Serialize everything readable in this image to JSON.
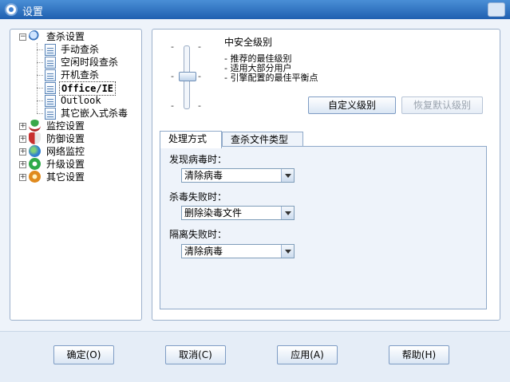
{
  "window": {
    "title": "设置"
  },
  "tree": {
    "root": {
      "label": "查杀设置",
      "icon": "magnifier-bug-icon"
    },
    "children": [
      {
        "label": "手动查杀"
      },
      {
        "label": "空闲时段查杀"
      },
      {
        "label": "开机查杀"
      },
      {
        "label": "Office/IE",
        "selected": true
      },
      {
        "label": "Outlook"
      },
      {
        "label": "其它嵌入式杀毒"
      }
    ],
    "categories": [
      {
        "label": "监控设置",
        "icon": "umbrella-icon"
      },
      {
        "label": "防御设置",
        "icon": "shield-icon"
      },
      {
        "label": "网络监控",
        "icon": "globe-icon"
      },
      {
        "label": "升级设置",
        "icon": "update-icon"
      },
      {
        "label": "其它设置",
        "icon": "gear-icon"
      }
    ]
  },
  "security_level": {
    "title": "中安全级别",
    "bullets": [
      "- 推荐的最佳级别",
      "- 适用大部分用户",
      "- 引擎配置的最佳平衡点"
    ],
    "tick_mark": "-",
    "level_index": 1,
    "level_count": 3,
    "custom_button": "自定义级别",
    "restore_button": "恢复默认级别"
  },
  "tabs": [
    {
      "label": "处理方式",
      "active": true
    },
    {
      "label": "查杀文件类型",
      "active": false
    }
  ],
  "handling": {
    "found_virus": {
      "label": "发现病毒时：",
      "value": "清除病毒"
    },
    "kill_failed": {
      "label": "杀毒失败时：",
      "value": "删除染毒文件"
    },
    "quarantine_failed": {
      "label": "隔离失败时：",
      "value": "清除病毒"
    }
  },
  "footer": {
    "ok": "确定(O)",
    "cancel": "取消(C)",
    "apply": "应用(A)",
    "help": "帮助(H)"
  },
  "colors": {
    "titlebar": "#1f5fb0",
    "panel_border": "#9db1cc",
    "window_bg": "#eef3fa"
  }
}
